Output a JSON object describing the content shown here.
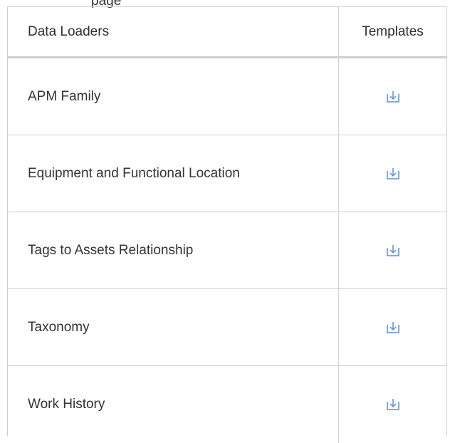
{
  "page": {
    "clipped_text": "page"
  },
  "table": {
    "headers": {
      "name": "Data Loaders",
      "templates": "Templates"
    },
    "rows": [
      {
        "name": "APM Family",
        "template_icon": "download-icon"
      },
      {
        "name": "Equipment and Functional Location",
        "template_icon": "download-icon"
      },
      {
        "name": "Tags to Assets Relationship",
        "template_icon": "download-icon"
      },
      {
        "name": "Taxonomy",
        "template_icon": "download-icon"
      },
      {
        "name": "Work History",
        "template_icon": "download-icon"
      }
    ]
  },
  "colors": {
    "icon": "#5b8ed6",
    "border": "#cfcfcf",
    "text": "#333333"
  }
}
